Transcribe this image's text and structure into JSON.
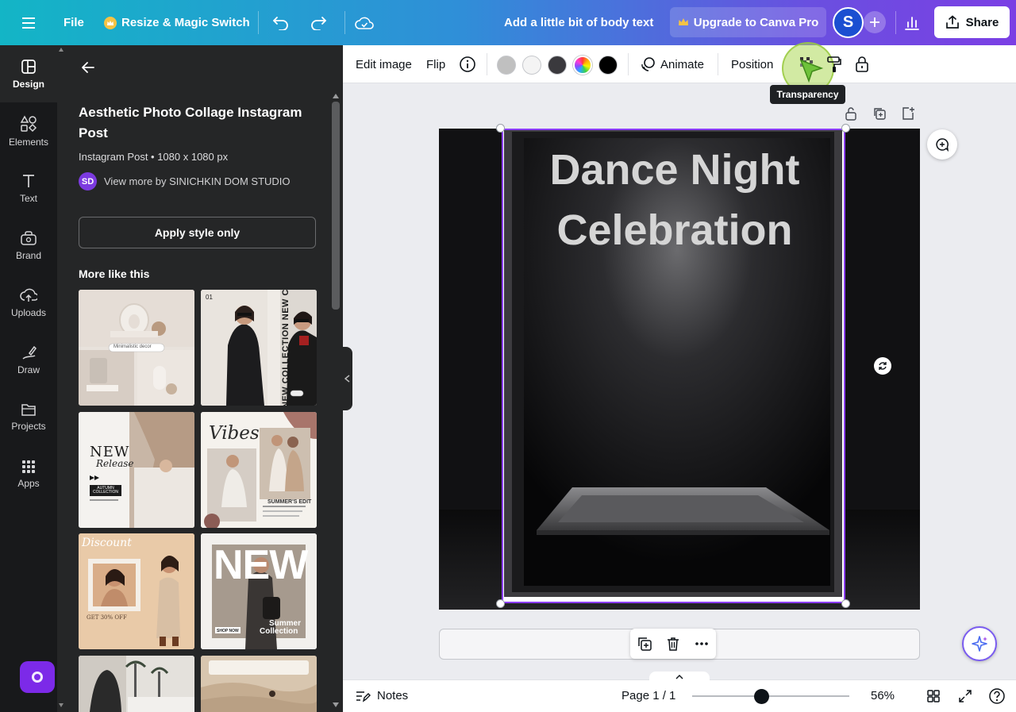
{
  "topbar": {
    "file_label": "File",
    "resize_label": "Resize & Magic Switch",
    "doc_title": "Add a little bit of body text",
    "upgrade_label": "Upgrade to Canva Pro",
    "avatar_initial": "S",
    "share_label": "Share"
  },
  "rail": {
    "items": [
      {
        "label": "Design",
        "icon": "design-icon"
      },
      {
        "label": "Elements",
        "icon": "elements-icon"
      },
      {
        "label": "Text",
        "icon": "text-icon"
      },
      {
        "label": "Brand",
        "icon": "brand-icon"
      },
      {
        "label": "Uploads",
        "icon": "uploads-icon"
      },
      {
        "label": "Draw",
        "icon": "draw-icon"
      },
      {
        "label": "Projects",
        "icon": "projects-icon"
      },
      {
        "label": "Apps",
        "icon": "apps-icon"
      }
    ]
  },
  "panel": {
    "title": "Aesthetic Photo Collage Instagram Post",
    "subtitle": "Instagram Post • 1080 x 1080 px",
    "author_badge": "SD",
    "author_link": "View more by SINICHKIN DOM STUDIO",
    "apply_label": "Apply style only",
    "more_title": "More like this",
    "thumbs": {
      "t1_search": "Minimalistic decor",
      "t2_num": "01",
      "t2_vertical": "NEW COLLECTION NEW CO",
      "t3_new": "NEW",
      "t3_release": "Release",
      "t3_box": "AUTUMN COLLECTION",
      "t4_vibes": "Vibes",
      "t4_caption": "SUMMER'S EDIT",
      "t5_discount": "Discount",
      "t5_offer": "GET 30% OFF",
      "t6_new": "NEW",
      "t6_shop": "SHOP NOW",
      "t6_summer": "Summer",
      "t6_collection": "Collection"
    }
  },
  "ctxbar": {
    "edit_image": "Edit image",
    "flip": "Flip",
    "animate": "Animate",
    "position": "Position",
    "tooltip": "Transparency",
    "swatches": [
      "#c0c0c0",
      "#f4f4f4",
      "#3a393d",
      "rainbow",
      "#000000"
    ]
  },
  "canvas": {
    "heading_line1": "Dance Night",
    "heading_line2": "Celebration"
  },
  "bottombar": {
    "notes_label": "Notes",
    "page_label": "Page 1 / 1",
    "zoom_label": "56%",
    "zoom_value": 0.56
  },
  "colors": {
    "accent_purple": "#7c2ae8",
    "selection": "#8b3dff"
  }
}
